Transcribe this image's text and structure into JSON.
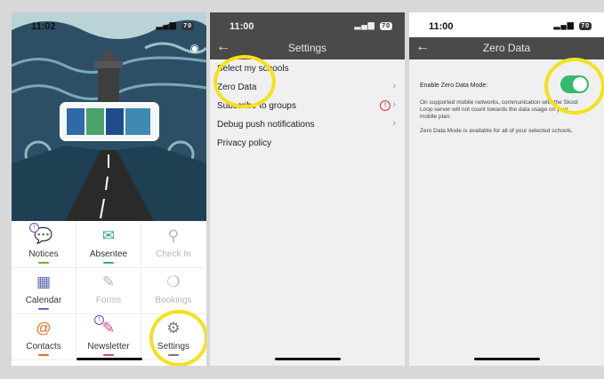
{
  "phone1": {
    "time": "11:02",
    "battery": "70",
    "tiles": [
      {
        "label": "Notices",
        "icon": "speech-bubble-icon",
        "color": "#6fae2f",
        "enabled": true,
        "badge": true
      },
      {
        "label": "Absentee",
        "icon": "envelope-icon",
        "color": "#3aa38c",
        "enabled": true,
        "badge": false
      },
      {
        "label": "Check In",
        "icon": "location-pin-icon",
        "color": "#b5b5b5",
        "enabled": false,
        "badge": false
      },
      {
        "label": "Calendar",
        "icon": "calendar-icon",
        "color": "#5a6bb0",
        "enabled": true,
        "badge": false
      },
      {
        "label": "Forms",
        "icon": "form-pencil-icon",
        "color": "#b5b5b5",
        "enabled": false,
        "badge": false
      },
      {
        "label": "Bookings",
        "icon": "chat-bubbles-icon",
        "color": "#b5b5b5",
        "enabled": false,
        "badge": false
      },
      {
        "label": "Contacts",
        "icon": "at-sign-icon",
        "color": "#e66b2b",
        "enabled": true,
        "badge": false
      },
      {
        "label": "Newsletter",
        "icon": "newsletter-icon",
        "color": "#d9467b",
        "enabled": true,
        "badge": true
      },
      {
        "label": "Settings",
        "icon": "gear-icon",
        "color": "#7a7a7a",
        "enabled": true,
        "badge": false
      }
    ]
  },
  "phone2": {
    "time": "11:00",
    "battery": "70",
    "title": "Settings",
    "rows": [
      {
        "label": "Select my schools",
        "chevron": false,
        "alert": false
      },
      {
        "label": "Zero Data",
        "chevron": true,
        "alert": false
      },
      {
        "label": "Subscribe to groups",
        "chevron": true,
        "alert": true
      },
      {
        "label": "Debug push notifications",
        "chevron": true,
        "alert": false
      },
      {
        "label": "Privacy policy",
        "chevron": false,
        "alert": false
      }
    ]
  },
  "phone3": {
    "time": "11:00",
    "battery": "70",
    "title": "Zero Data",
    "toggle_label": "Enable Zero Data Mode:",
    "toggle_on": true,
    "desc1": "On supported mobile networks, communication with the Skool Loop server will not count towards the data usage on your mobile plan.",
    "desc2": "Zero Data Mode is available for all of your selected schools."
  },
  "colors": {
    "highlight": "#f4e11a",
    "toggle_on": "#33b96b",
    "navbar": "#4a4a4a"
  }
}
